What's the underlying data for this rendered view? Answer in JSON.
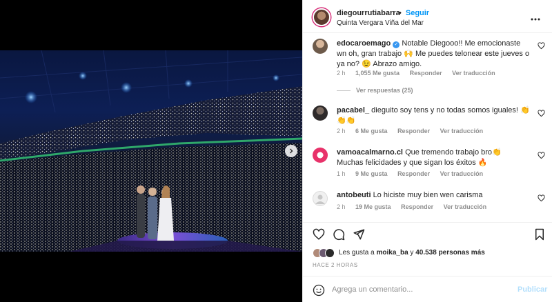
{
  "post": {
    "username": "diegourrutiabarra",
    "separator": "•",
    "follow_label": "Seguir",
    "location": "Quinta Vergara Viña del Mar",
    "more_icon": "more-horizontal-icon"
  },
  "comments": [
    {
      "username": "edocaroemago",
      "verified": true,
      "text": "Notable Diegooo!! Me emocionaste wn oh, gran trabajo 🙌 Me puedes telonear este jueves o ya no? 😉 Abrazo amigo.",
      "time": "2 h",
      "likes": "1,055 Me gusta",
      "reply": "Responder",
      "translate": "Ver traducción",
      "view_replies": "Ver respuestas (25)"
    },
    {
      "username": "pacabel_",
      "verified": false,
      "text": "dieguito soy tens y no todas somos iguales! 👏👏👏",
      "time": "2 h",
      "likes": "6 Me gusta",
      "reply": "Responder",
      "translate": "Ver traducción"
    },
    {
      "username": "vamoacalmarno.cl",
      "verified": false,
      "text": "Que tremendo trabajo bro👏 Muchas felicidades y que sigan los éxitos 🔥",
      "time": "1 h",
      "likes": "9 Me gusta",
      "reply": "Responder",
      "translate": "Ver traducción"
    },
    {
      "username": "antobeuti",
      "verified": false,
      "text": "Lo hiciste muy bien wen carisma",
      "time": "2 h",
      "likes": "19 Me gusta",
      "reply": "Responder",
      "translate": "Ver traducción"
    }
  ],
  "likes": {
    "prefix": "Les gusta a",
    "user": "moika_ba",
    "middle": "y",
    "count": "40.538 personas más"
  },
  "time_ago": "HACE 2 HORAS",
  "composer": {
    "placeholder": "Agrega un comentario...",
    "publish_label": "Publicar"
  },
  "colors": {
    "accent": "#0095f6",
    "publish_disabled": "#b2dffc",
    "meta": "#8e8e8e"
  }
}
